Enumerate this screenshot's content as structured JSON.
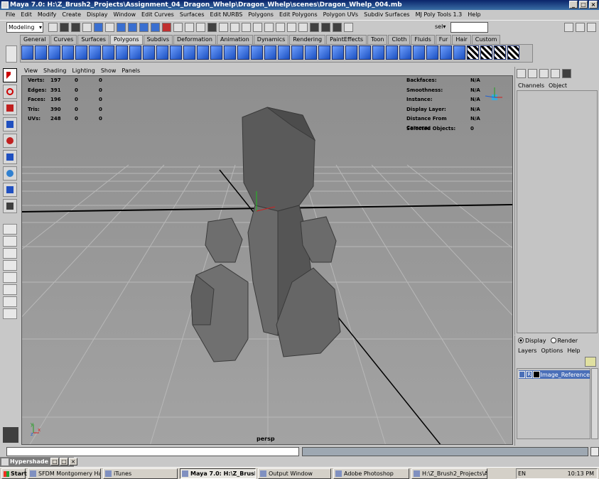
{
  "window": {
    "title": "Maya 7.0: H:\\Z_Brush2_Projects\\Assignment_04_Dragon_Whelp\\Dragon_Whelp\\scenes\\Dragon_Whelp_004.mb",
    "min": "_",
    "max": "□",
    "close": "×"
  },
  "menu": [
    "File",
    "Edit",
    "Modify",
    "Create",
    "Display",
    "Window",
    "Edit Curves",
    "Surfaces",
    "Edit NURBS",
    "Polygons",
    "Edit Polygons",
    "Polygon UVs",
    "Subdiv Surfaces",
    "MJ Poly Tools 1.3",
    "Help"
  ],
  "status": {
    "mode": "Modeling",
    "sel_label": "sel▾"
  },
  "shelf_tabs": [
    "General",
    "Curves",
    "Surfaces",
    "Polygons",
    "Subdivs",
    "Deformation",
    "Animation",
    "Dynamics",
    "Rendering",
    "PaintEffects",
    "Toon",
    "Cloth",
    "Fluids",
    "Fur",
    "Hair",
    "Custom"
  ],
  "shelf_active": "Polygons",
  "viewport": {
    "menu": [
      "View",
      "Shading",
      "Lighting",
      "Show",
      "Panels"
    ],
    "hud_left": [
      {
        "k": "Verts:",
        "a": "197",
        "b": "0",
        "c": "0"
      },
      {
        "k": "Edges:",
        "a": "391",
        "b": "0",
        "c": "0"
      },
      {
        "k": "Faces:",
        "a": "196",
        "b": "0",
        "c": "0"
      },
      {
        "k": "Tris:",
        "a": "390",
        "b": "0",
        "c": "0"
      },
      {
        "k": "UVs:",
        "a": "248",
        "b": "0",
        "c": "0"
      }
    ],
    "hud_right": [
      {
        "k": "Backfaces:",
        "v": "N/A"
      },
      {
        "k": "Smoothness:",
        "v": "N/A"
      },
      {
        "k": "Instance:",
        "v": "N/A"
      },
      {
        "k": "Display Layer:",
        "v": "N/A"
      },
      {
        "k": "Distance From Camera:",
        "v": "N/A"
      },
      {
        "k": "Selected Objects:",
        "v": "0"
      }
    ],
    "camera": "persp",
    "axis_x": "x",
    "axis_y": "y",
    "axis_z": "z"
  },
  "channel_box": {
    "tabs": [
      "Channels",
      "Object"
    ]
  },
  "layer_editor": {
    "display": "Display",
    "render": "Render",
    "menu": [
      "Layers",
      "Options",
      "Help"
    ],
    "layers": [
      {
        "r": "R",
        "name": "Image_Reference"
      }
    ]
  },
  "hypershade": {
    "title": "Hypershade"
  },
  "taskbar": {
    "start": "Start",
    "tasks": [
      "SFDM Montgomery Hall I...",
      "iTunes",
      "Maya 7.0: H:\\Z_Brush...",
      "Output Window",
      "Adobe Photoshop",
      "H:\\Z_Brush2_Projects\\A..."
    ],
    "active": "Maya 7.0: H:\\Z_Brush...",
    "lang": "EN",
    "time": "10:13 PM"
  },
  "colors": {
    "viewport_top": "#8e8e8e",
    "viewport_bottom": "#a3a3a3",
    "selection": "#4a6fb8",
    "title_bar": "#0a246a"
  }
}
